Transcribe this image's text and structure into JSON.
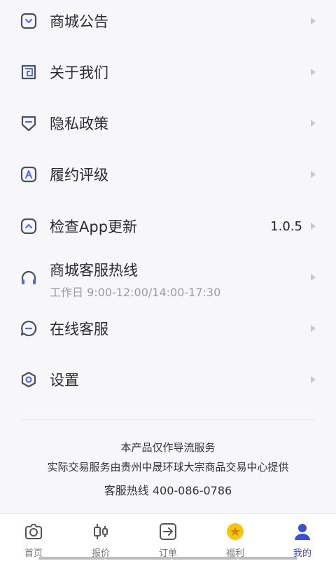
{
  "menu": {
    "items": [
      {
        "label": "商城公告",
        "icon": "envelope-chevron-icon"
      },
      {
        "label": "关于我们",
        "icon": "maze-icon"
      },
      {
        "label": "隐私政策",
        "icon": "shield-icon"
      },
      {
        "label": "履约评级",
        "icon": "rating-a-icon"
      },
      {
        "label": "检查App更新",
        "value": "1.0.5",
        "icon": "update-chevron-icon"
      },
      {
        "label": "商城客服热线",
        "sub": "工作日 9:00-12:00/14:00-17:30",
        "icon": "headphones-icon"
      },
      {
        "label": "在线客服",
        "icon": "chat-icon"
      },
      {
        "label": "设置",
        "icon": "settings-hex-icon"
      }
    ]
  },
  "footer": {
    "line1": "本产品仅作导流服务",
    "line2": "实际交易服务由贵州中晟环球大宗商品交易中心提供",
    "line3": "客服热线 400-086-0786"
  },
  "tabbar": {
    "tabs": [
      {
        "label": "首页",
        "icon": "camera-icon"
      },
      {
        "label": "报价",
        "icon": "candlestick-icon"
      },
      {
        "label": "订单",
        "icon": "arrow-box-icon"
      },
      {
        "label": "福利",
        "icon": "star-coin-icon"
      },
      {
        "label": "我的",
        "icon": "user-icon"
      }
    ],
    "active": "我的"
  },
  "colors": {
    "accent": "#3b4fd6",
    "icon_stroke": "#4a4f63",
    "icon_fill": "#4e6cf0",
    "coin": "#f6c511"
  }
}
